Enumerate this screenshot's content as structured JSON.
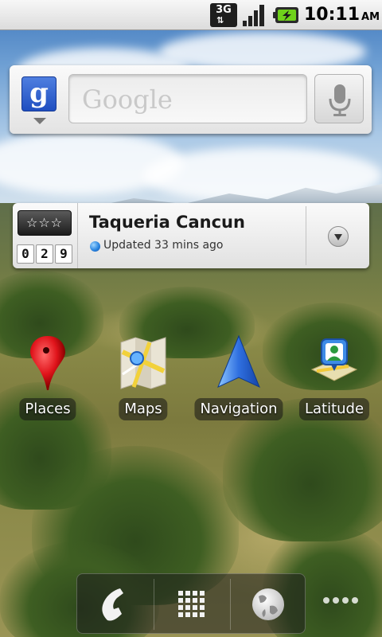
{
  "status_bar": {
    "network_label": "3G",
    "time": "10:11",
    "ampm": "AM",
    "icons": [
      "3g-data-icon",
      "signal-strength-icon",
      "battery-charging-icon"
    ]
  },
  "search_widget": {
    "logo_letter": "g",
    "placeholder": "Google",
    "icons": [
      "google-logo-icon",
      "dropdown-arrow-icon",
      "microphone-icon"
    ]
  },
  "places_widget": {
    "rating_stars": "☆☆☆",
    "counter_digits": [
      "0",
      "2",
      "9"
    ],
    "place_name": "Taqueria Cancun",
    "status_text": "Updated 33 mins ago",
    "icons": [
      "status-dot-icon",
      "dropdown-circle-icon"
    ]
  },
  "apps": [
    {
      "label": "Places",
      "icon": "map-pin-icon"
    },
    {
      "label": "Maps",
      "icon": "maps-icon"
    },
    {
      "label": "Navigation",
      "icon": "navigation-arrow-icon"
    },
    {
      "label": "Latitude",
      "icon": "latitude-icon"
    }
  ],
  "dock": {
    "items": [
      "phone-icon",
      "app-drawer-grid-icon",
      "browser-globe-icon"
    ]
  },
  "colors": {
    "status_bar": "#e8e8e8",
    "accent_blue": "#1f4ec0",
    "pin_red": "#e0141b",
    "nav_blue": "#2f6fe0"
  }
}
